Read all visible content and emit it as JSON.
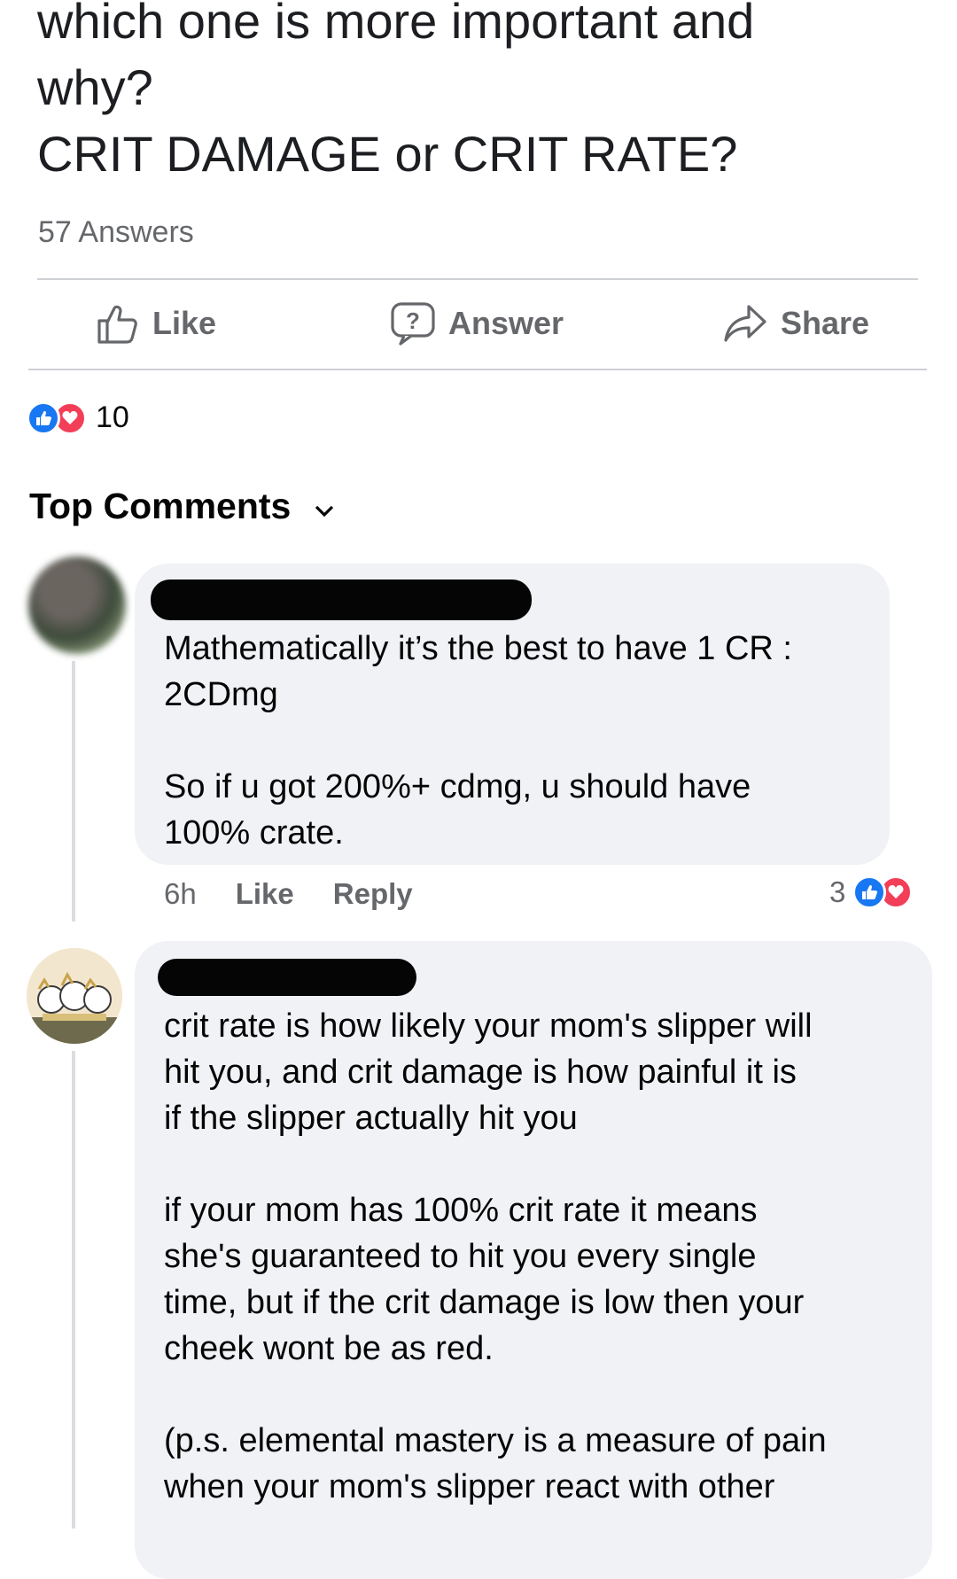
{
  "question": {
    "title": "which one is more important and\nwhy?\nCRIT DAMAGE or CRIT RATE?",
    "answers_count": "57 Answers"
  },
  "actions": {
    "like_label": "Like",
    "answer_label": "Answer",
    "share_label": "Share"
  },
  "reactions": {
    "count": "10",
    "icons": [
      "like-icon",
      "love-icon"
    ]
  },
  "comments_section": {
    "label": "Top Comments"
  },
  "comments": [
    {
      "text": "Mathematically it’s the best to have 1 CR :\n2CDmg\n\nSo if u got 200%+ cdmg, u should have\n100% crate.",
      "time": "6h",
      "like_label": "Like",
      "reply_label": "Reply",
      "reaction_count": "3"
    },
    {
      "text": "crit rate is how likely your mom's slipper will\nhit you, and crit damage is how painful it is\nif the slipper actually hit you\n\nif your mom has 100% crit rate it means\nshe's guaranteed to hit you every single\ntime, but if the crit damage is low then your\ncheek wont be as red.\n\n(p.s. elemental mastery is a measure of pain\nwhen your mom's slipper react with other"
    }
  ],
  "colors": {
    "text_primary": "#050505",
    "text_secondary": "#65676b",
    "bubble_bg": "#f0f2f5",
    "like_blue": "#1877f2",
    "love_red": "#f33e58",
    "divider": "#ced0d4"
  }
}
